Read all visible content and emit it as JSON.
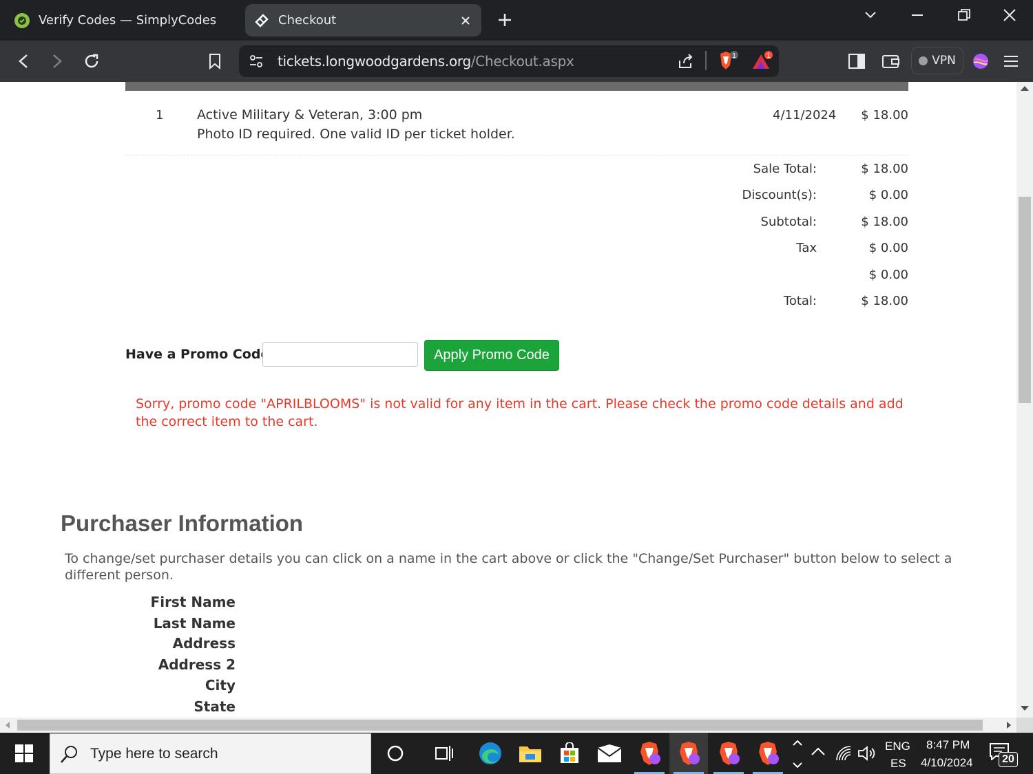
{
  "browser": {
    "tabs": [
      {
        "title": "Verify Codes — SimplyCodes",
        "active": false
      },
      {
        "title": "Checkout",
        "active": true
      }
    ],
    "url_host": "tickets.longwoodgardens.org",
    "url_path": "/Checkout.aspx",
    "shields_count": "1",
    "rewards_count": "1",
    "vpn_label": "VPN"
  },
  "cart": {
    "item": {
      "qty": "1",
      "name": "Active Military & Veteran, 3:00 pm",
      "note": "Photo ID required. One valid ID per ticket holder.",
      "date": "4/11/2024",
      "price": "$ 18.00"
    },
    "summary": [
      {
        "label": "Sale Total:",
        "value": "$ 18.00"
      },
      {
        "label": "Discount(s):",
        "value": "$ 0.00"
      },
      {
        "label": "Subtotal:",
        "value": "$ 18.00"
      },
      {
        "label": "Tax",
        "value": "$ 0.00"
      },
      {
        "label": "",
        "value": "$ 0.00"
      },
      {
        "label": "Total:",
        "value": "$ 18.00"
      }
    ]
  },
  "promo": {
    "label": "Have a Promo Code?",
    "input_value": "",
    "button_label": "Apply Promo Code",
    "error": "Sorry, promo code \"APRILBLOOMS\" is not valid for any item in the cart. Please check the promo code details and add the correct item to the cart."
  },
  "purchaser": {
    "heading": "Purchaser Information",
    "instructions": "To change/set purchaser details you can click on a name in the cart above or click the \"Change/Set Purchaser\" button below to select a different person.",
    "fields": [
      "First Name",
      "Last Name",
      "Address",
      "Address 2",
      "City",
      "State"
    ]
  },
  "taskbar": {
    "search_placeholder": "Type here to search",
    "lang_line1": "ENG",
    "lang_line2": "ES",
    "time": "8:47 PM",
    "date": "4/10/2024",
    "notification_count": "20"
  },
  "colors": {
    "accent_green": "#1aa43a",
    "error_red": "#e63a2b",
    "chrome_dark": "#202124"
  }
}
